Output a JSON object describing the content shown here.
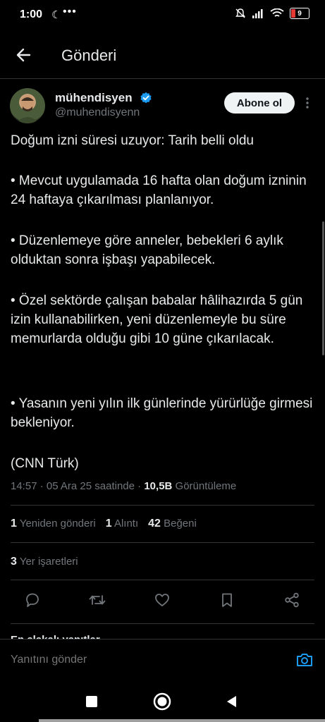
{
  "status_bar": {
    "time": "1:00",
    "more": "•••",
    "battery": "9"
  },
  "header": {
    "title": "Gönderi"
  },
  "author": {
    "name": "mühendisyen",
    "handle": "@muhendisyenn",
    "follow_label": "Abone ol"
  },
  "post": {
    "paragraphs": [
      "Doğum izni süresi uzuyor: Tarih belli oldu",
      "• Mevcut uygulamada 16 hafta olan doğum izninin 24 haftaya çıkarılması planlanıyor.",
      "• Düzenlemeye göre anneler, bebekleri 6 aylık olduktan sonra işbaşı yapabilecek.",
      "• Özel sektörde çalışan babalar hâlihazırda 5 gün izin kullanabilirken, yeni düzenlemeyle bu süre memurlarda olduğu gibi 10 güne çıkarılacak.",
      "• Yasanın yeni yılın ilk günlerinde yürürlüğe girmesi bekleniyor.",
      "(CNN Türk)"
    ],
    "time": "14:57",
    "date": "05 Ara 25 saatinde",
    "views_count": "10,5B",
    "views_label": "Görüntüleme"
  },
  "stats": {
    "reposts_count": "1",
    "reposts_label": "Yeniden gönderi",
    "quotes_count": "1",
    "quotes_label": "Alıntı",
    "likes_count": "42",
    "likes_label": "Beğeni",
    "bookmarks_count": "3",
    "bookmarks_label": "Yer işaretleri"
  },
  "replies": {
    "peek_label": "En alakalı yanıtlar"
  },
  "composer": {
    "placeholder": "Yanıtını gönder"
  },
  "colors": {
    "background": "#000000",
    "text": "#e7e9ea",
    "muted": "#71767b",
    "divider": "#2f3336",
    "accent": "#1d9bf0"
  }
}
